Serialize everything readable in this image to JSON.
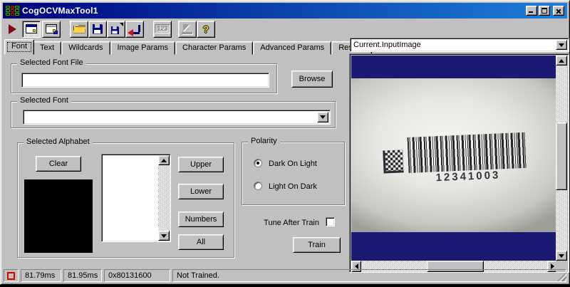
{
  "window": {
    "title": "CogOCVMaxTool1"
  },
  "titlebar": {
    "icon": "cognex-grid-icon",
    "controls": [
      "minimize-icon",
      "maximize-icon",
      "close-icon"
    ]
  },
  "toolbar": {
    "buttons": [
      {
        "icon": "run-icon",
        "pressed": false,
        "disabled": false
      },
      {
        "icon": "show-image-window-icon",
        "pressed": true,
        "disabled": false
      },
      {
        "icon": "float-window-icon",
        "pressed": false,
        "disabled": false
      },
      {
        "icon": "open-file-icon",
        "pressed": false,
        "disabled": false
      },
      {
        "icon": "save-file-icon",
        "pressed": false,
        "disabled": false
      },
      {
        "icon": "save-as-icon",
        "pressed": false,
        "disabled": false
      },
      {
        "icon": "reset-icon",
        "pressed": false,
        "disabled": false
      },
      {
        "icon": "data-grid-icon",
        "label": "123",
        "pressed": false,
        "disabled": true
      },
      {
        "icon": "pointer-tool-icon",
        "pressed": false,
        "disabled": true
      },
      {
        "icon": "help-icon",
        "label": "?",
        "pressed": false,
        "disabled": false
      }
    ]
  },
  "tabs": [
    {
      "label": "Font",
      "selected": true
    },
    {
      "label": "Text",
      "selected": false
    },
    {
      "label": "Wildcards",
      "selected": false
    },
    {
      "label": "Image Params",
      "selected": false
    },
    {
      "label": "Character Params",
      "selected": false
    },
    {
      "label": "Advanced Params",
      "selected": false
    },
    {
      "label": "Results",
      "selected": false
    }
  ],
  "image_selector": {
    "value": "Current.InputImage",
    "icon": "dropdown-arrow-icon"
  },
  "font_tab": {
    "font_file_group": {
      "label": "Selected Font File",
      "path_value": "",
      "browse_label": "Browse"
    },
    "font_group": {
      "label": "Selected Font",
      "selected_value": ""
    },
    "alphabet_group": {
      "label": "Selected Alphabet",
      "clear_label": "Clear",
      "preview_background": "#000000",
      "list_items": [],
      "buttons": [
        "Upper",
        "Lower",
        "Numbers",
        "All"
      ]
    },
    "polarity_group": {
      "label": "Polarity",
      "options": [
        {
          "label": "Dark On Light",
          "selected": true
        },
        {
          "label": "Light On Dark",
          "selected": false
        }
      ]
    },
    "tune_after_train": {
      "label": "Tune After Train",
      "checked": false
    },
    "train_label": "Train"
  },
  "image_view": {
    "barcode_text": "12341003",
    "band_color": "#1a1a72"
  },
  "status_bar": {
    "indicator_icon": "record-indicator-icon",
    "indicator_color": "#e00000",
    "execution_time": "81.79ms",
    "total_time": "81.95ms",
    "result_code": "0x80131600",
    "message": "Not Trained."
  }
}
